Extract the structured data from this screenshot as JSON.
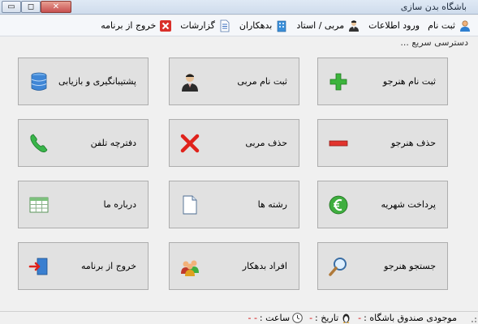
{
  "window": {
    "title": "باشگاه بدن سازی",
    "minimize_glyph": "▭",
    "maximize_glyph": "◻",
    "close_glyph": "✕"
  },
  "menu": [
    {
      "label": "ثبت نام",
      "icon": "user-icon"
    },
    {
      "label": "ورود اطلاعات",
      "icon": ""
    },
    {
      "label": "مربی / استاد",
      "icon": "coach-icon"
    },
    {
      "label": "بدهکاران",
      "icon": "building-icon"
    },
    {
      "label": "گزارشات",
      "icon": "report-icon"
    },
    {
      "label": "خروج از برنامه",
      "icon": "close-x-icon"
    }
  ],
  "quick_access": "دسترسی سریع ...",
  "buttons": {
    "register_student": "ثبت نام هنرجو",
    "register_coach": "ثبت نام  مربی",
    "backup_restore": "پشتیبانگیری و بازیابی",
    "delete_student": "حذف هنرجو",
    "delete_coach": "حذف مربی",
    "phonebook": "دفترچه تلفن",
    "pay_tuition": "پرداخت شهریه",
    "fields": "رشته ها",
    "about": "درباره ما",
    "search_student": "جستجو هنرجو",
    "debtors": "افراد بدهکار",
    "exit": "خروج از برنامه"
  },
  "status": {
    "balance_label": "موجودی صندوق باشگاه :",
    "balance_value": "-",
    "date_label": "تاریخ :",
    "date_value": "-",
    "time_label": "ساعت :",
    "time_value": "- -"
  },
  "colors": {
    "accent_red": "#d00000",
    "button_bg": "#e1e1e1",
    "plus_green": "#3cb43c"
  }
}
